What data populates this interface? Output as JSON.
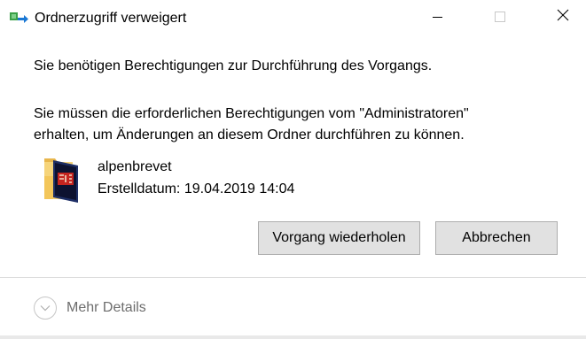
{
  "window": {
    "title": "Ordnerzugriff verweigert",
    "icon": "folder-access-arrow-icon"
  },
  "controls": {
    "minimize_icon": "minimize-icon",
    "maximize_icon": "maximize-icon",
    "close_icon": "close-icon"
  },
  "message": {
    "line1": "Sie benötigen Berechtigungen zur Durchführung des Vorgangs.",
    "line2a": "Sie müssen die erforderlichen Berechtigungen vom \"Administratoren\"",
    "line2b": "erhalten, um Änderungen an diesem Ordner durchführen zu können."
  },
  "item": {
    "name": "alpenbrevet",
    "date_label": "Erstelldatum:",
    "date_value": "19.04.2019 14:04",
    "icon": "folder-icon"
  },
  "buttons": {
    "retry_label": "Vorgang wiederholen",
    "cancel_label": "Abbrechen"
  },
  "footer": {
    "details_label": "Mehr Details",
    "details_icon": "chevron-down-icon"
  },
  "colors": {
    "button_bg": "#e1e1e1",
    "button_border": "#adadad",
    "muted_text": "#6d6d6d",
    "accent_blue": "#1a78d4",
    "accent_green": "#3aa047"
  }
}
